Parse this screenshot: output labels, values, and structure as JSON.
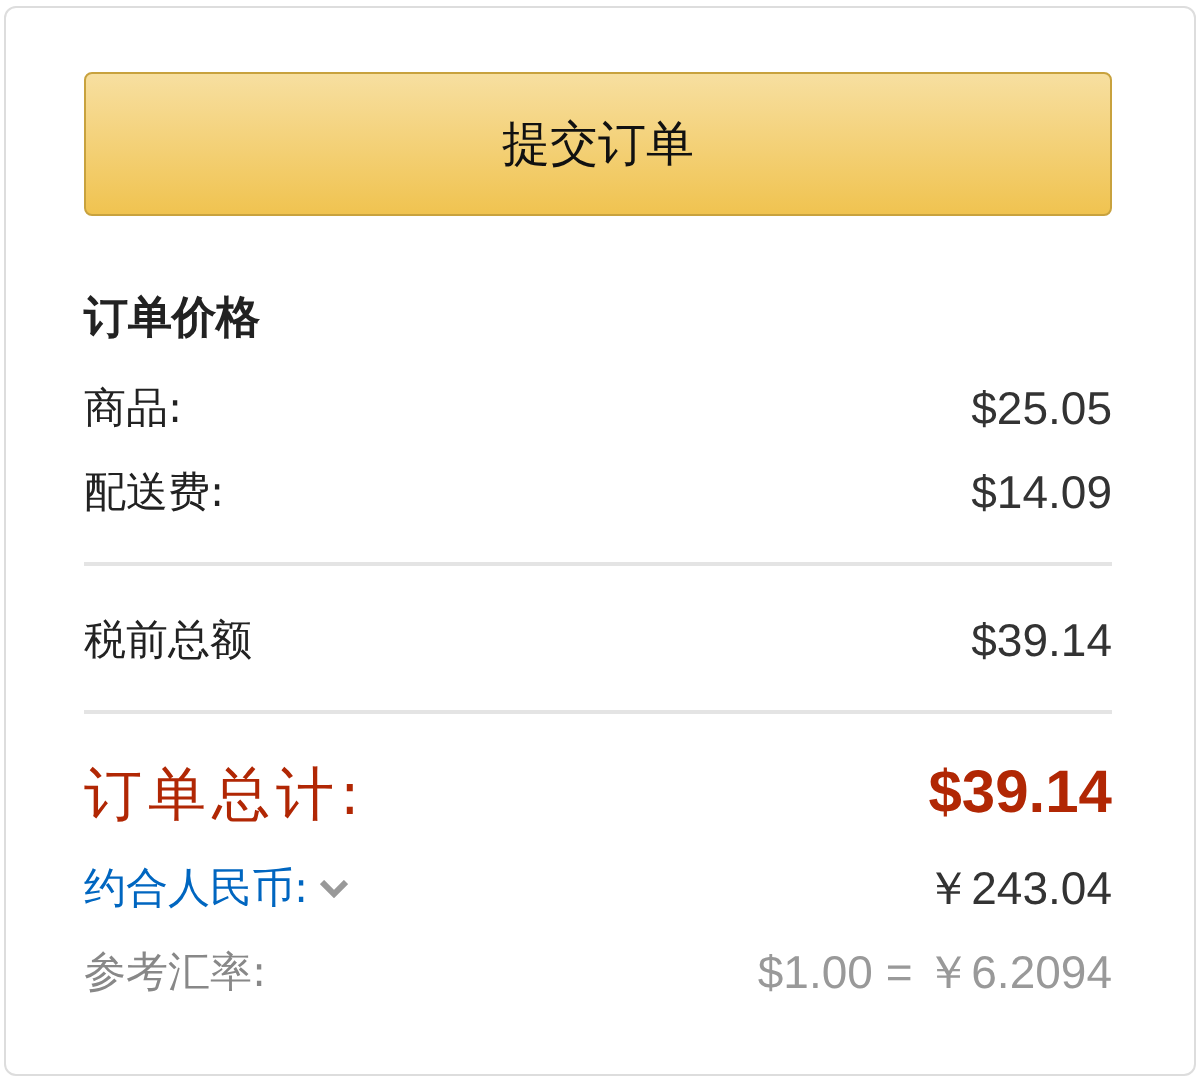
{
  "submit_button": {
    "label": "提交订单"
  },
  "heading": "订单价格",
  "line_items": [
    {
      "label": "商品:",
      "amount": "$25.05"
    },
    {
      "label": "配送费:",
      "amount": "$14.09"
    }
  ],
  "pretax": {
    "label": "税前总额",
    "amount": "$39.14"
  },
  "order_total": {
    "label": "订单总计:",
    "amount": "$39.14"
  },
  "conversion": {
    "label": "约合人民币:",
    "amount": "￥243.04"
  },
  "exchange_rate": {
    "label": "参考汇率:",
    "amount": "$1.00 = ￥6.2094"
  }
}
